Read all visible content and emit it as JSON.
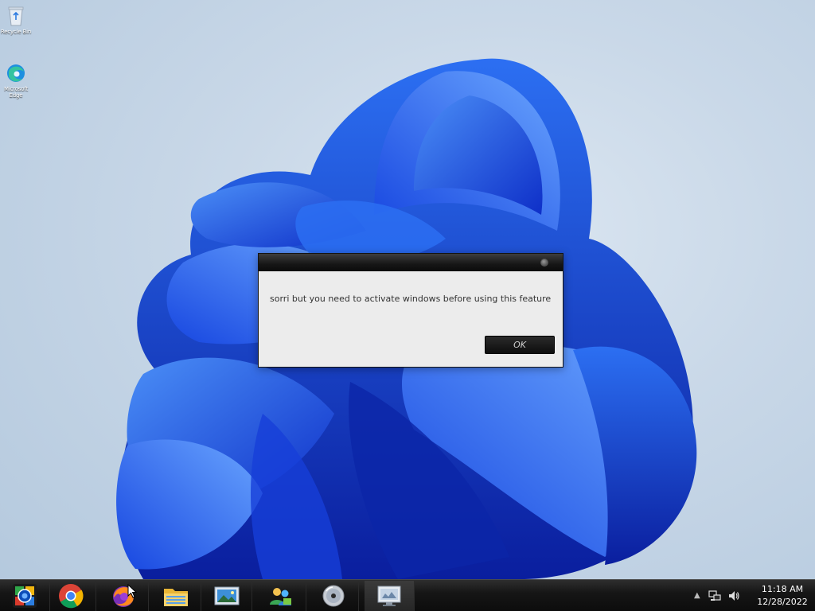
{
  "desktop": {
    "icons": [
      {
        "label": "Recycle Bin",
        "icon": "recycle-bin-icon"
      },
      {
        "label": "Microsoft Edge",
        "icon": "edge-icon"
      }
    ]
  },
  "dialog": {
    "message": "sorri but you need to activate windows before using this feature",
    "ok_label": "OK"
  },
  "taskbar": {
    "apps": [
      {
        "name": "start",
        "icon": "start-orb-icon"
      },
      {
        "name": "chrome",
        "icon": "chrome-icon"
      },
      {
        "name": "firefox",
        "icon": "firefox-icon"
      },
      {
        "name": "file-explorer",
        "icon": "folder-icon"
      },
      {
        "name": "photo-viewer",
        "icon": "photo-icon"
      },
      {
        "name": "users",
        "icon": "users-icon"
      },
      {
        "name": "disc",
        "icon": "disc-icon"
      },
      {
        "name": "monitor",
        "icon": "monitor-icon"
      }
    ],
    "clock": {
      "time": "11:18 AM",
      "date": "12/28/2022"
    }
  },
  "colors": {
    "accent": "#1f5eea",
    "taskbar": "#161616",
    "dialog_bg": "#ececec"
  }
}
